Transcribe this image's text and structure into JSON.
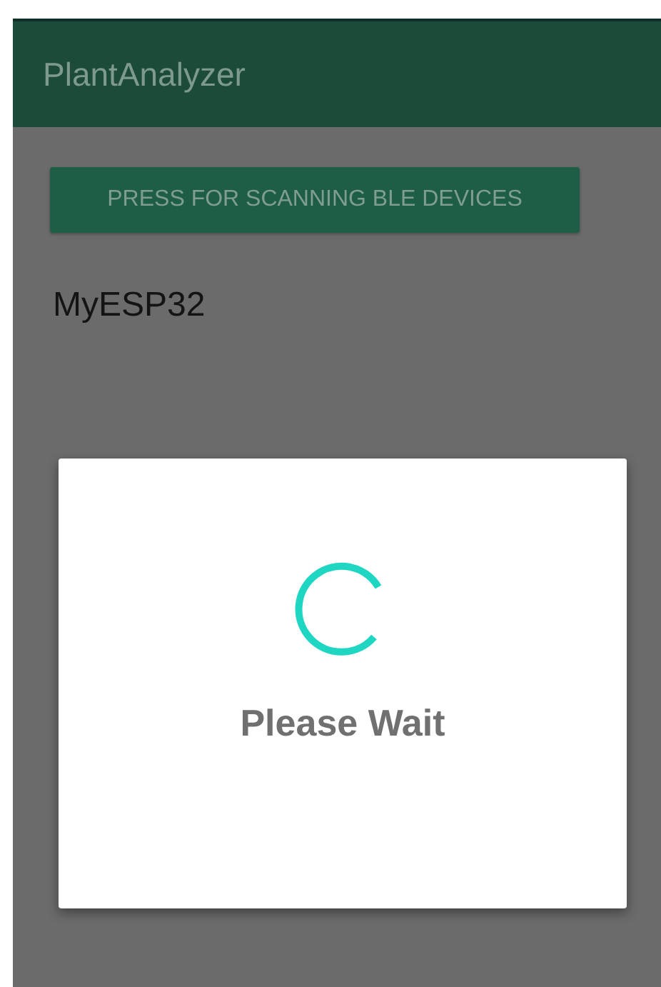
{
  "app_bar": {
    "title": "PlantAnalyzer"
  },
  "scan_button": {
    "label": "PRESS FOR SCANNING BLE DEVICES"
  },
  "devices": [
    {
      "name": "MyESP32"
    }
  ],
  "dialog": {
    "message": "Please Wait"
  }
}
